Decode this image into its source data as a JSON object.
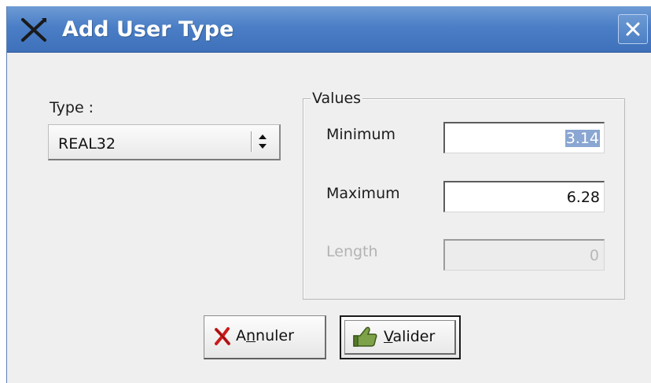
{
  "window": {
    "title": "Add User Type"
  },
  "form": {
    "type_label": "Type :",
    "type_value": "REAL32",
    "values_legend": "Values",
    "minimum": {
      "label": "Minimum",
      "value": "3.14",
      "selected": true
    },
    "maximum": {
      "label": "Maximum",
      "value": "6.28"
    },
    "length": {
      "label": "Length",
      "value": "0",
      "disabled": true
    }
  },
  "buttons": {
    "cancel": {
      "label_pre": "A",
      "label_mnemonic": "n",
      "label_post": "nuler"
    },
    "ok": {
      "label_pre": "",
      "label_mnemonic": "V",
      "label_post": "alider"
    }
  },
  "colors": {
    "titlebar": "#4a7ec6",
    "selection": "#8aa6d2",
    "cancel_icon": "#cc1b1b",
    "ok_icon": "#6a8f3a"
  },
  "icons": {
    "app": "x-tools-icon",
    "close": "close-icon",
    "select": "spin-arrows-icon",
    "cancel": "red-x-icon",
    "ok": "thumbs-up-icon"
  }
}
